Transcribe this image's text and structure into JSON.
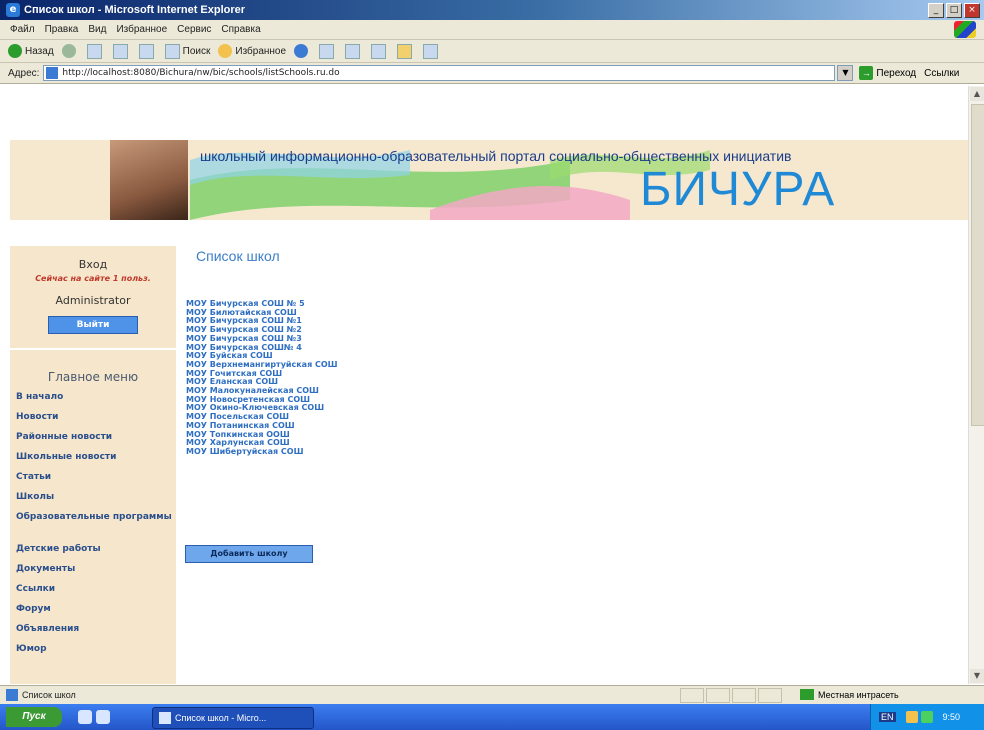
{
  "window": {
    "title": "Список школ - Microsoft Internet Explorer",
    "app_icon": "ie-icon"
  },
  "menu": [
    "Файл",
    "Правка",
    "Вид",
    "Избранное",
    "Сервис",
    "Справка"
  ],
  "toolbar": {
    "back": "Назад",
    "search": "Поиск",
    "favorites": "Избранное"
  },
  "address": {
    "label": "Адрес:",
    "url": "http://localhost:8080/Bichura/nw/bic/schools/listSchools.ru.do",
    "go": "Переход",
    "links": "Ссылки"
  },
  "banner": {
    "slogan": "школьный информационно-образовательный портал социально-общественных инициатив",
    "brand": "БИЧУРА"
  },
  "login": {
    "title": "Вход",
    "online": "Сейчас на сайте 1 польз.",
    "user": "Administrator",
    "logout": "Выйти"
  },
  "main_menu": {
    "title": "Главное меню",
    "items": [
      "В начало",
      "Новости",
      "Районные новости",
      "Школьные новости",
      "Статьи",
      "Школы",
      "Образовательные программы",
      "Детские работы",
      "Документы",
      "Ссылки",
      "Форум",
      "Объявления",
      "Юмор"
    ]
  },
  "page": {
    "title": "Список школ",
    "schools": [
      "МОУ Бичурская СОШ № 5",
      "МОУ Билютайская СОШ",
      "МОУ Бичурская СОШ №1",
      "МОУ Бичурская СОШ №2",
      "МОУ Бичурская СОШ №3",
      "МОУ Бичурская СОШ№ 4",
      "МОУ Буйская СОШ",
      "МОУ Верхнемангиртуйская СОШ",
      "МОУ Гочитская СОШ",
      "МОУ Еланская СОШ",
      "МОУ Малокуналейская СОШ",
      "МОУ Новосретенская СОШ",
      "МОУ Окино-Ключевская СОШ",
      "МОУ Посельская СОШ",
      "МОУ Потанинская СОШ",
      "МОУ Топкинская ООШ",
      "МОУ Харлунская СОШ",
      "МОУ Шибертуйская СОШ"
    ],
    "add_button": "Добавить школу"
  },
  "status": {
    "text": "Список школ",
    "zone": "Местная интрасеть"
  },
  "taskbar": {
    "start": "Пуск",
    "task": "Список школ - Micro...",
    "lang": "EN",
    "clock": "9:50"
  }
}
